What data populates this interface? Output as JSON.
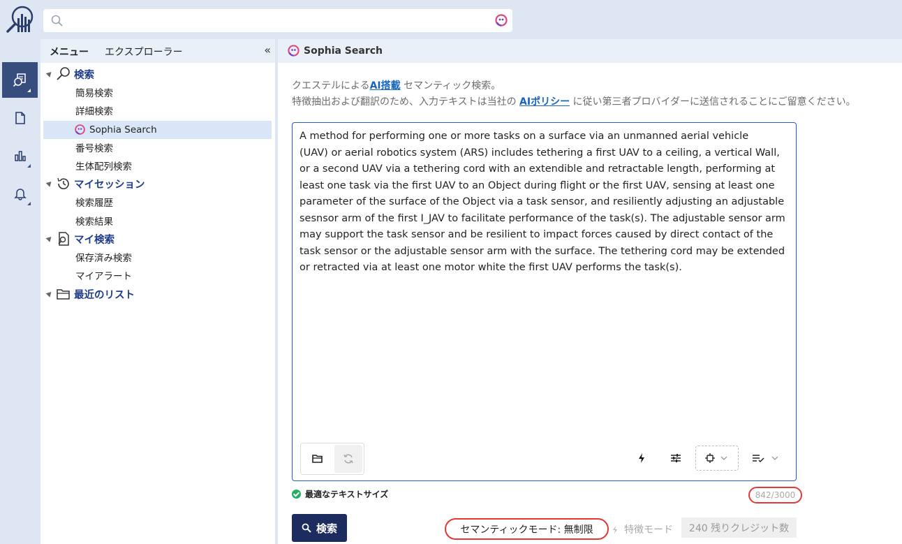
{
  "app": {
    "logo_icon": "analytics-magnifier-logo",
    "search": {
      "placeholder": "",
      "value": ""
    }
  },
  "rail": {
    "items": [
      {
        "icon": "search-document-icon",
        "active": true
      },
      {
        "icon": "document-icon",
        "active": false
      },
      {
        "icon": "bar-chart-icon",
        "active": false
      },
      {
        "icon": "bell-icon",
        "active": false
      }
    ]
  },
  "left_panel": {
    "tabs": [
      "メニュー",
      "エクスプローラー"
    ],
    "collapse_label": "«",
    "sections": [
      {
        "label": "検索",
        "icon": "search-icon",
        "items": [
          "簡易検索",
          "詳細検索",
          "Sophia Search",
          "番号検索",
          "生体配列検索"
        ]
      },
      {
        "label": "マイセッション",
        "icon": "history-icon",
        "items": [
          "検索履歴",
          "検索結果"
        ]
      },
      {
        "label": "マイ検索",
        "icon": "saved-search-icon",
        "items": [
          "保存済み検索",
          "マイアラート"
        ]
      },
      {
        "label": "最近のリスト",
        "icon": "folder-icon",
        "items": []
      }
    ],
    "selected_item": "Sophia Search"
  },
  "main": {
    "title": "Sophia Search",
    "desc_line1_pre": "クエステルによる",
    "desc_line1_link": "AI搭載",
    "desc_line1_post": " セマンティック検索。",
    "desc_line2_pre": "特徴抽出および翻訳のため、入力テキストは当社の ",
    "desc_line2_link": "AIポリシー",
    "desc_line2_post": " に従い第三者プロバイダーに送信されることにご留意ください。",
    "editor_text": "A method for performing one or more tasks on a surface via an unmanned aerial vehicle\n(UAV) or aerial robotics system (ARS) includes tethering a first UAV to a ceiling, a vertical Wall, or a second UAV via a tethering cord with an extendible and retractable length, performing at least one task via the first UAV to an Object during flight or the first UAV, sensing at least one parameter of the surface of the Object via a task sensor, and resiliently adjusting an adjustable sesnsor arm of the first I_JAV to facilitate performance of the task(s). The adjustable sensor arm may support the task sensor and be resilient to impact forces caused by direct contact of the task sensor or the adjustable sensor arm with the surface. The tethering cord may be extended or retracted via at least one motor white the first UAV performs the task(s).",
    "status_text": "最適なテキストサイズ",
    "counter": "842/3000",
    "search_button": "検索",
    "semantic_mode": "セマンティックモード: 無制限",
    "feature_mode": "特徴モード",
    "credits": "240 残りクレジット数"
  }
}
